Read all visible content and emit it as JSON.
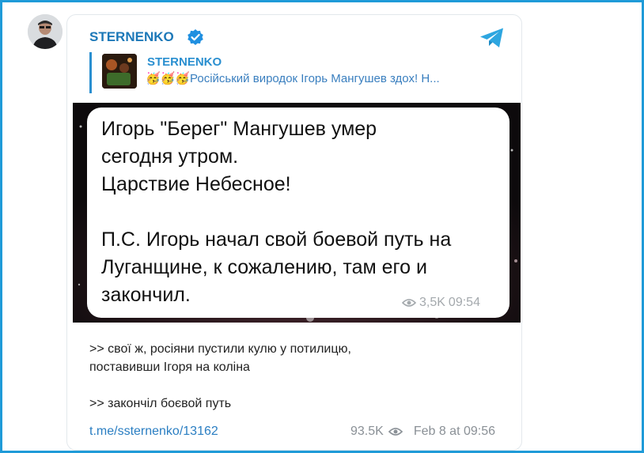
{
  "colors": {
    "frame_border": "#1f9bd8",
    "channel_name": "#1c78b8",
    "reply_accent": "#2a8fd0",
    "link": "#2a7ec2"
  },
  "post": {
    "channel_name": "STERNENKO",
    "verified_icon": "verified-badge-icon",
    "app_icon": "telegram-icon",
    "reply": {
      "channel_name": "STERNENKO",
      "preview_text": "🥳🥳🥳Російський виродок Ігорь Мангушев здох! Н..."
    },
    "image_bubble": {
      "text": "Игорь \"Берег\" Мангушев умер\nсегодня утром.\nЦарствие Небесное!\n\nП.С. Игорь начал свой боевой путь на\nЛуганщине, к сожалению, там его и\nзакончил.",
      "views": "3,5K",
      "time": "09:54"
    },
    "caption": {
      "line1": ">> свої ж, росіяни пустили кулю у потилицю,",
      "line2": "поставивши Ігоря на коліна",
      "line3": ">> закончіл боєвой путь"
    },
    "link": "t.me/ssternenko/13162",
    "views": "93.5K",
    "date": "Feb 8 at 09:56"
  }
}
